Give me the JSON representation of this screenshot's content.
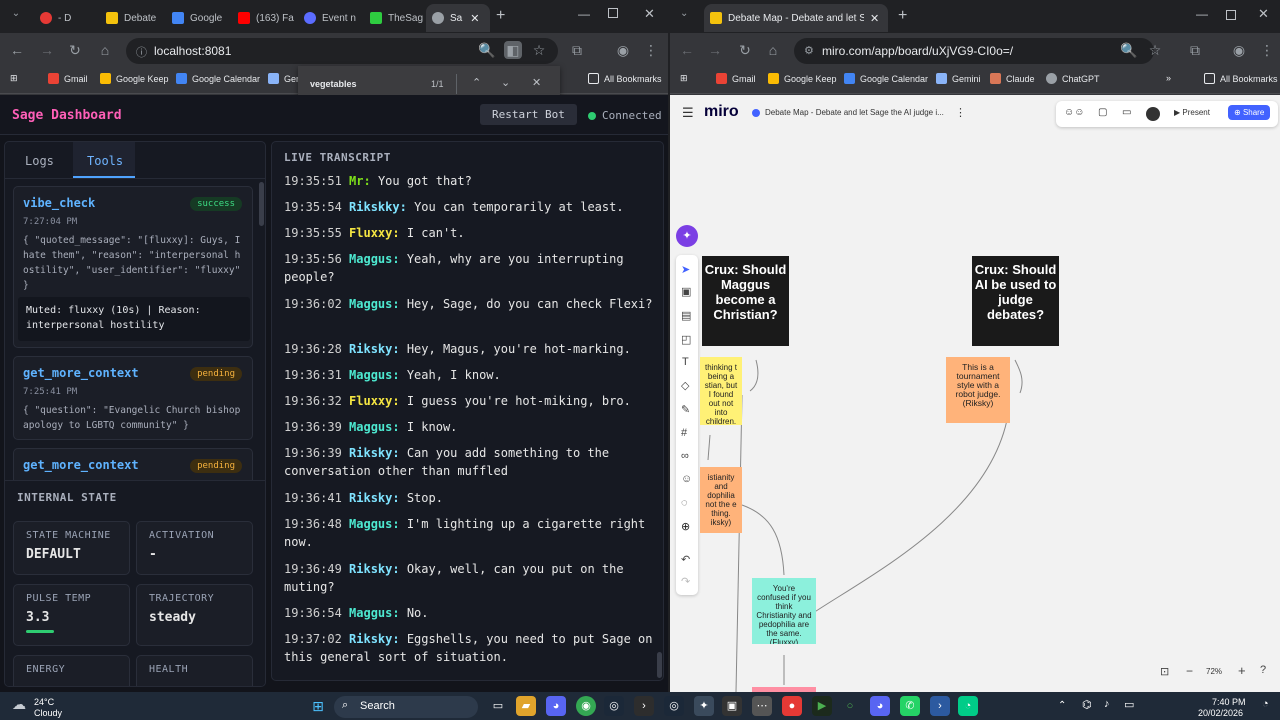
{
  "left_browser": {
    "tabs": [
      {
        "label": "- D",
        "color": "#e53935"
      },
      {
        "label": "Debate",
        "color": "#f4c20d"
      },
      {
        "label": "Google",
        "color": "#4285f4"
      },
      {
        "label": "(163) Fa",
        "color": "#ff0000"
      },
      {
        "label": "Event n",
        "color": "#5b6cff"
      },
      {
        "label": "TheSag",
        "color": "#2ecc40"
      },
      {
        "label": "Sa",
        "color": "#9aa0a6"
      }
    ],
    "url": "localhost:8081",
    "find_bar": {
      "query": "vegetables",
      "count": "1/1"
    },
    "bookmarks": [
      "Gmail",
      "Google Keep",
      "Google Calendar",
      "Ger"
    ],
    "all_bookmarks": "All Bookmarks"
  },
  "dashboard": {
    "title": "Sage Dashboard",
    "restart_label": "Restart Bot",
    "status": "Connected",
    "tabs": [
      "Logs",
      "Tools"
    ],
    "tools": [
      {
        "name": "vibe_check",
        "status": "success",
        "time": "7:27:04 PM",
        "payload": "{ \"quoted_message\": \"[fluxxy]: Guys, I hate them\", \"reason\": \"interpersonal hostility\", \"user_identifier\": \"fluxxy\" }",
        "result": "Muted: fluxxy (10s) | Reason: interpersonal hostility"
      },
      {
        "name": "get_more_context",
        "status": "pending",
        "time": "7:25:41 PM",
        "payload": "{ \"question\": \"Evangelic Church bishop apology to LGBTQ community\" }"
      },
      {
        "name": "get_more_context",
        "status": "pending"
      }
    ],
    "internal_state": {
      "title": "INTERNAL STATE",
      "state_machine_label": "STATE MACHINE",
      "state_machine": "DEFAULT",
      "activation_label": "ACTIVATION",
      "activation": "-",
      "pulse_label": "PULSE TEMP",
      "pulse": "3.3",
      "trajectory_label": "TRAJECTORY",
      "trajectory": "steady",
      "energy_label": "ENERGY",
      "health_label": "HEALTH"
    },
    "transcript_title": "LIVE TRANSCRIPT",
    "transcript": [
      {
        "time": "19:35:51",
        "speaker": "Mr:",
        "text": "You got that?",
        "color": "#7ee01a"
      },
      {
        "time": "19:35:54",
        "speaker": "Rikskky:",
        "text": "You can temporarily at least.",
        "color": "#7fe3ff"
      },
      {
        "time": "19:35:55",
        "speaker": "Fluxxy:",
        "text": "I can't.",
        "color": "#f5e642"
      },
      {
        "time": "19:35:56",
        "speaker": "Maggus:",
        "text": "Yeah, why are you interrupting people?",
        "color": "#4de8d0"
      },
      {
        "time": "19:36:02",
        "speaker": "Maggus:",
        "text": "Hey, Sage, do you can check Flexi?",
        "color": "#4de8d0"
      },
      {
        "time": "19:36:28",
        "speaker": "Riksky:",
        "text": "Hey, Magus, you're hot-marking.",
        "color": "#7fe3ff"
      },
      {
        "time": "19:36:31",
        "speaker": "Maggus:",
        "text": "Yeah, I know.",
        "color": "#4de8d0"
      },
      {
        "time": "19:36:32",
        "speaker": "Fluxxy:",
        "text": "I guess you're hot-miking, bro.",
        "color": "#f5e642"
      },
      {
        "time": "19:36:39",
        "speaker": "Maggus:",
        "text": "I know.",
        "color": "#4de8d0"
      },
      {
        "time": "19:36:39",
        "speaker": "Riksky:",
        "text": "Can you add something to the conversation other than muffled",
        "color": "#7fe3ff"
      },
      {
        "time": "19:36:41",
        "speaker": "Riksky:",
        "text": "Stop.",
        "color": "#7fe3ff"
      },
      {
        "time": "19:36:48",
        "speaker": "Maggus:",
        "text": "I'm lighting up a cigarette right now.",
        "color": "#4de8d0"
      },
      {
        "time": "19:36:49",
        "speaker": "Riksky:",
        "text": "Okay, well, can you put on the muting?",
        "color": "#7fe3ff"
      },
      {
        "time": "19:36:54",
        "speaker": "Maggus:",
        "text": "No.",
        "color": "#4de8d0"
      },
      {
        "time": "19:37:02",
        "speaker": "Riksky:",
        "text": "Eggshells, you need to put Sage on this general sort of situation.",
        "color": "#7fe3ff"
      }
    ]
  },
  "right_browser": {
    "tab_label": "Debate Map - Debate and let Sage th",
    "url": "miro.com/app/board/uXjVG9-CI0o=/",
    "bookmarks": [
      "Gmail",
      "Google Keep",
      "Google Calendar",
      "Gemini",
      "Claude",
      "ChatGPT"
    ],
    "all_bookmarks": "All Bookmarks"
  },
  "miro": {
    "logo": "miro",
    "board_title": "Debate Map - Debate and let Sage the AI judge i...",
    "present_label": "Present",
    "share_label": "Share",
    "zoom": "72%",
    "crux1": "Crux: Should Maggus become a Christian?",
    "crux2": "Crux: Should AI be used to judge debates?",
    "sticky_yellow": "thinking t being a stian, but I found out not into children. aggus)",
    "sticky_orange_left": "istianity and dophilia not the e thing. iksky)",
    "sticky_orange_right": "This is a tournament style with a robot judge. (Riksky)",
    "sticky_green": "You're confused if you think Christianity and pedophilia are the same. (Fluxxy)"
  },
  "taskbar": {
    "weather_temp": "24°C",
    "weather_desc": "Cloudy",
    "search": "Search",
    "time": "7:40 PM",
    "date": "20/02/2026"
  }
}
